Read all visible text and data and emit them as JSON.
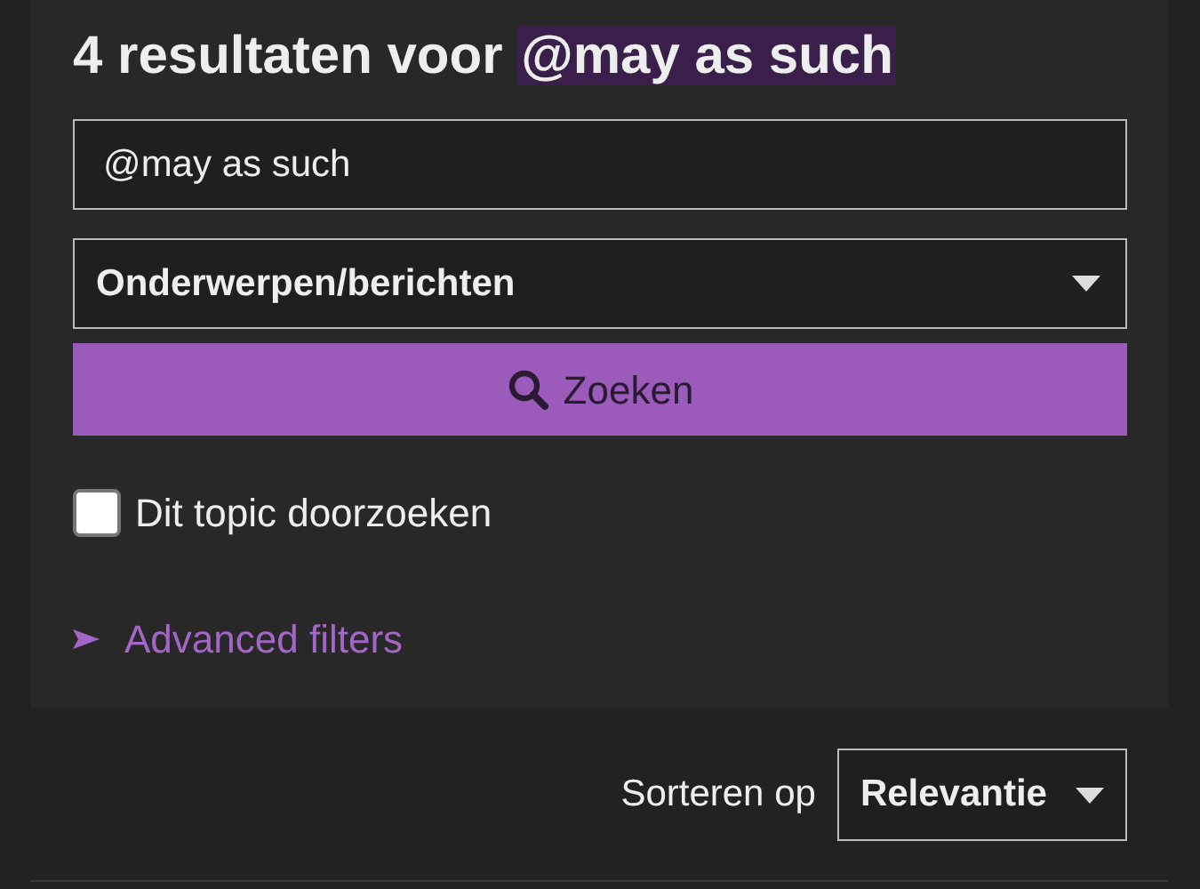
{
  "heading": {
    "prefix": "4 resultaten voor",
    "query": "@may as such"
  },
  "search": {
    "value": "@may as such"
  },
  "type_select": {
    "value": "Onderwerpen/berichten"
  },
  "search_button": {
    "label": "Zoeken"
  },
  "this_topic": {
    "label": "Dit topic doorzoeken",
    "checked": false
  },
  "advanced_filters": {
    "label": "Advanced filters",
    "expanded": false
  },
  "sort": {
    "label": "Sorteren op",
    "value": "Relevantie"
  }
}
